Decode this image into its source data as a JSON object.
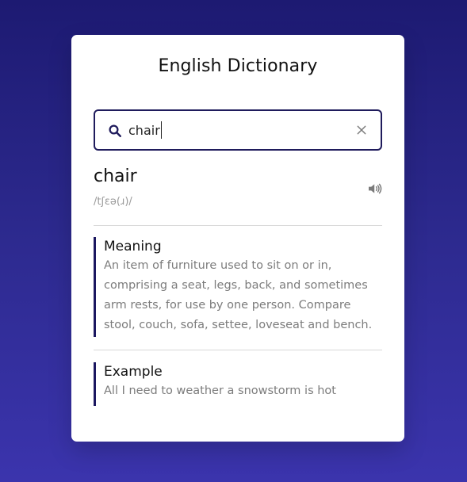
{
  "app": {
    "title": "English Dictionary"
  },
  "search": {
    "value": "chair",
    "placeholder": ""
  },
  "result": {
    "word": "chair",
    "phonetic": "/tʃɛə(ɹ)/",
    "meaning_label": "Meaning",
    "meaning_text": "An item of furniture used to sit on or in, comprising a seat, legs, back, and sometimes arm rests, for use by one person. Compare stool, couch, sofa, settee, loveseat and bench.",
    "example_label": "Example",
    "example_text": "All I need to weather a snowstorm is hot"
  },
  "icons": {
    "search": "search-icon",
    "clear": "close-icon",
    "speaker": "speaker-icon"
  },
  "colors": {
    "accent": "#1f1b5c",
    "background_top": "#1d1a72",
    "background_bottom": "#3b34ad",
    "card": "#ffffff",
    "muted_text": "#7c7c7c"
  }
}
